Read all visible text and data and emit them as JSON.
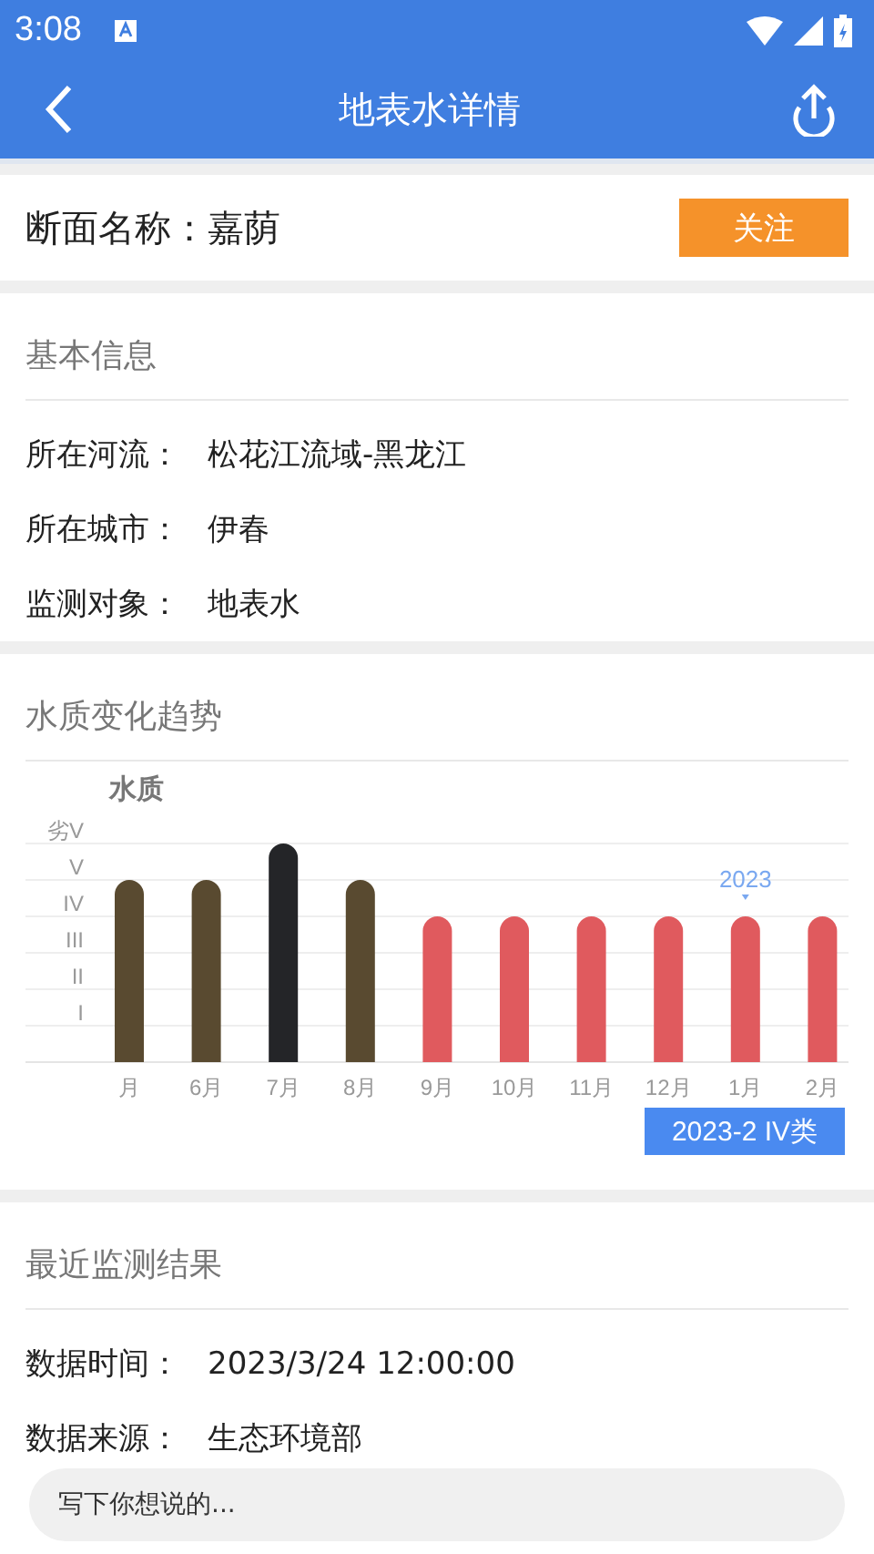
{
  "status_bar": {
    "time": "3:08"
  },
  "app_bar": {
    "title": "地表水详情"
  },
  "station": {
    "label": "断面名称：",
    "name": "嘉荫",
    "follow_button": "关注"
  },
  "basic_info": {
    "title": "基本信息",
    "rows": [
      {
        "label": "所在河流：",
        "value": "松花江流域-黑龙江"
      },
      {
        "label": "所在城市：",
        "value": "伊春"
      },
      {
        "label": "监测对象：",
        "value": "地表水"
      }
    ]
  },
  "trend": {
    "title": "水质变化趋势",
    "axis_title": "水质",
    "y_axis_labels": [
      "劣V",
      "V",
      "IV",
      "III",
      "II",
      "I"
    ],
    "bars": [
      {
        "label": "月",
        "color": "#594a30",
        "kind": "class5"
      },
      {
        "label": "6月",
        "color": "#594a30",
        "kind": "class5"
      },
      {
        "label": "7月",
        "color": "#242528",
        "kind": "worse"
      },
      {
        "label": "8月",
        "color": "#594a30",
        "kind": "class5"
      },
      {
        "label": "9月",
        "color": "#e05a5e",
        "kind": "class4"
      },
      {
        "label": "10月",
        "color": "#e05a5e",
        "kind": "class4"
      },
      {
        "label": "11月",
        "color": "#e05a5e",
        "kind": "class4"
      },
      {
        "label": "12月",
        "color": "#e05a5e",
        "kind": "class4"
      },
      {
        "label": "1月",
        "color": "#e05a5e",
        "kind": "class4"
      },
      {
        "label": "2月",
        "color": "#e05a5e",
        "kind": "class4"
      }
    ],
    "year_marker": "2023",
    "tooltip": "2023-2 IV类"
  },
  "latest": {
    "title": "最近监测结果",
    "rows": [
      {
        "label": "数据时间：",
        "value": "2023/3/24 12:00:00"
      },
      {
        "label": "数据来源：",
        "value": "生态环境部"
      }
    ]
  },
  "comment": {
    "placeholder": "写下你想说的..."
  }
}
